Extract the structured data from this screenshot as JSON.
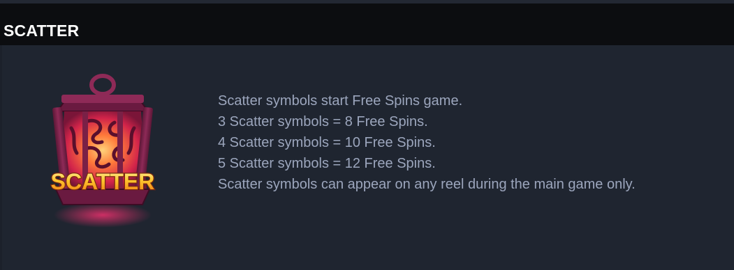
{
  "section": {
    "title": "SCATTER"
  },
  "symbol": {
    "icon": "scatter-lantern-icon",
    "label": "SCATTER"
  },
  "description": [
    "Scatter symbols start Free Spins game.",
    "3 Scatter symbols = 8 Free Spins.",
    "4 Scatter symbols = 10 Free Spins.",
    "5 Scatter symbols = 12 Free Spins.",
    "Scatter symbols can appear on any reel during the main game only."
  ],
  "colors": {
    "header_bg": "#0c0d10",
    "panel_bg": "#1f2530",
    "title_text": "#ffffff",
    "body_text": "#9ca6bd",
    "lantern_frame": "#7a2046",
    "lantern_glow": "#ff6a3d",
    "label_gold": "#ffc83a"
  }
}
